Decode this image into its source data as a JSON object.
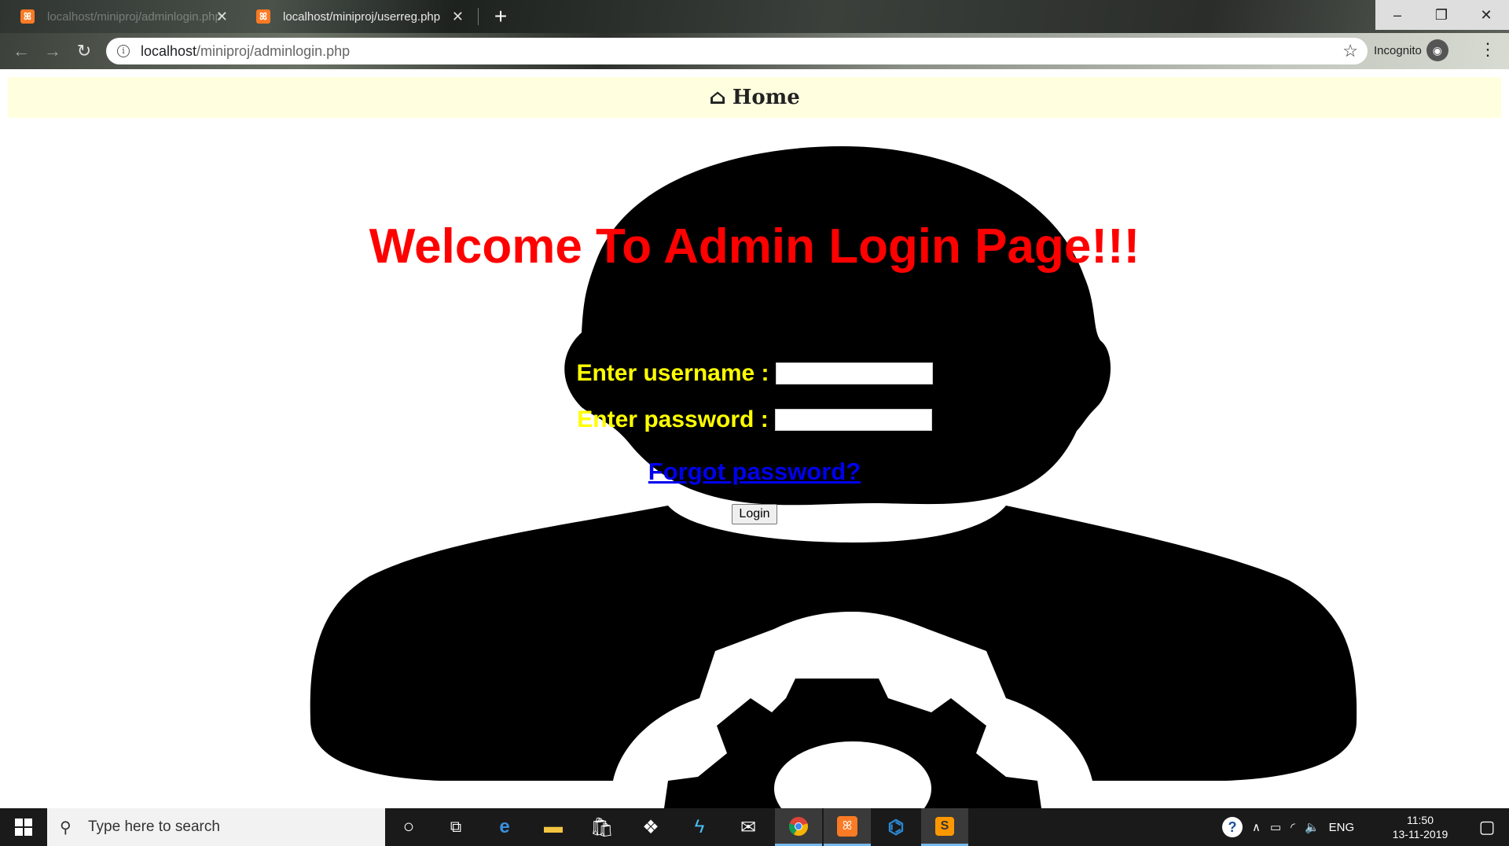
{
  "browser": {
    "tabs": [
      {
        "title": "localhost/miniproj/adminlogin.php",
        "favicon": "xampp-icon",
        "active": false
      },
      {
        "title": "localhost/miniproj/userreg.php",
        "favicon": "xampp-icon",
        "active": true
      }
    ],
    "favicon_glyph": "ꕤ",
    "close_glyph": "✕",
    "new_tab_glyph": "+",
    "url_host": "localhost",
    "url_path": "/miniproj/adminlogin.php",
    "incognito_label": "Incognito",
    "window_controls": {
      "minimize": "–",
      "maximize": "❐",
      "close": "✕"
    }
  },
  "page": {
    "nav": {
      "home_label": "Home",
      "home_icon": "⌂"
    },
    "welcome_title": "Welcome To Admin Login Page!!!",
    "form": {
      "username_label": "Enter username :",
      "password_label": "Enter password :",
      "username_value": "",
      "password_value": "",
      "forgot_link": "Forgot password?",
      "login_button": "Login"
    },
    "colors": {
      "title": "#ff0000",
      "labels": "#ffff00",
      "link": "#0000ee",
      "navbar_bg": "#ffffe0"
    }
  },
  "taskbar": {
    "search_placeholder": "Type here to search",
    "tray": {
      "language": "ENG",
      "time": "11:50",
      "date": "13-11-2019"
    }
  }
}
